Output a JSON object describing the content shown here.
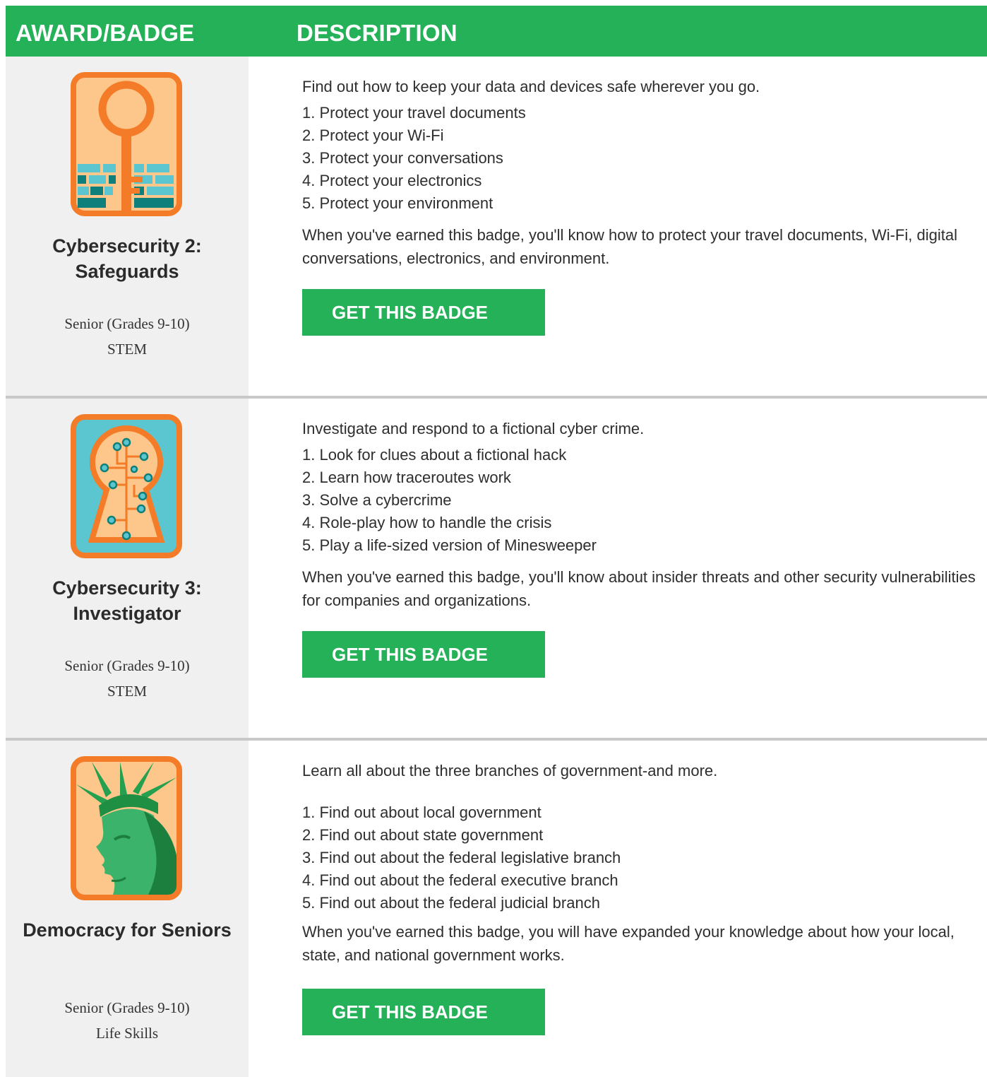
{
  "header": {
    "award_col": "AWARD/BADGE",
    "desc_col": "DESCRIPTION"
  },
  "colors": {
    "brand_green": "#25b158",
    "badge_orange": "#f47b27",
    "badge_peach": "#fdc68a",
    "badge_teal": "#5bc6cf",
    "badge_dark_teal": "#0e7f7a",
    "liberty_green": "#25a04f"
  },
  "badges": [
    {
      "title": "Cybersecurity 2: Safeguards",
      "level": "Senior (Grades 9-10)",
      "category": "STEM",
      "icon": "key-brick-wall-badge-icon",
      "intro": "Find out how to keep your data and devices safe wherever you go.",
      "steps": [
        "1. Protect your travel documents",
        "2. Protect your Wi-Fi",
        "3. Protect your conversations",
        "4. Protect your electronics",
        "5. Protect your environment"
      ],
      "outro": "When you've earned this badge, you'll know how to protect your travel documents, Wi-Fi, digital conversations, electronics, and environment.",
      "button": "GET THIS BADGE"
    },
    {
      "title": "Cybersecurity 3: Investigator",
      "level": "Senior (Grades 9-10)",
      "category": "STEM",
      "icon": "keyhole-circuit-badge-icon",
      "intro": "Investigate and respond to a fictional cyber crime.",
      "steps": [
        "1. Look for clues about a fictional hack",
        "2. Learn how traceroutes work",
        "3. Solve a cybercrime",
        "4. Role-play how to handle the crisis",
        "5. Play a life-sized version of Minesweeper"
      ],
      "outro": "When you've earned this badge, you'll know about insider threats and other security vulnerabilities for companies and organizations.",
      "button": "GET THIS BADGE"
    },
    {
      "title": "Democracy for Seniors",
      "level": "Senior (Grades 9-10)",
      "category": "Life Skills",
      "icon": "statue-of-liberty-badge-icon",
      "intro": "Learn all about the three branches of government-and more.",
      "steps": [
        "1. Find out about local government",
        "2. Find out about state government",
        "3. Find out about the federal legislative branch",
        "4. Find out about the federal executive branch",
        "5. Find out about the federal judicial branch"
      ],
      "outro": "When you've earned this badge, you will have expanded your knowledge about how your local, state, and national government works.",
      "button": "GET THIS BADGE"
    }
  ]
}
